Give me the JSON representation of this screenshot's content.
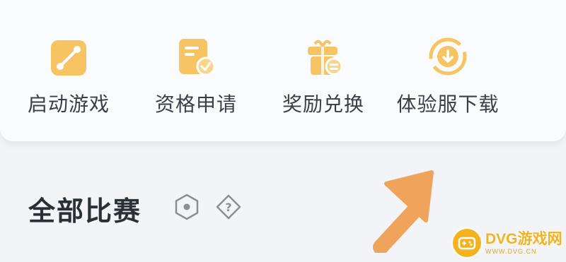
{
  "quick_actions": [
    {
      "label": "启动游戏",
      "icon": "launch-game-icon"
    },
    {
      "label": "资格申请",
      "icon": "application-doc-icon"
    },
    {
      "label": "奖励兑换",
      "icon": "gift-redeem-icon"
    },
    {
      "label": "体验服下载",
      "icon": "download-refresh-icon"
    }
  ],
  "section": {
    "title": "全部比赛",
    "icons": [
      "hexagon-settings-icon",
      "help-question-icon"
    ]
  },
  "overlay": {
    "icon": "pointer-arrow-icon"
  },
  "watermark": {
    "name": "DVG游戏网",
    "url": "WWW.DVG.CN"
  },
  "colors": {
    "icon_accent": "#f6c462",
    "arrow": "#f0a35a",
    "watermark": "#f2b31f"
  }
}
